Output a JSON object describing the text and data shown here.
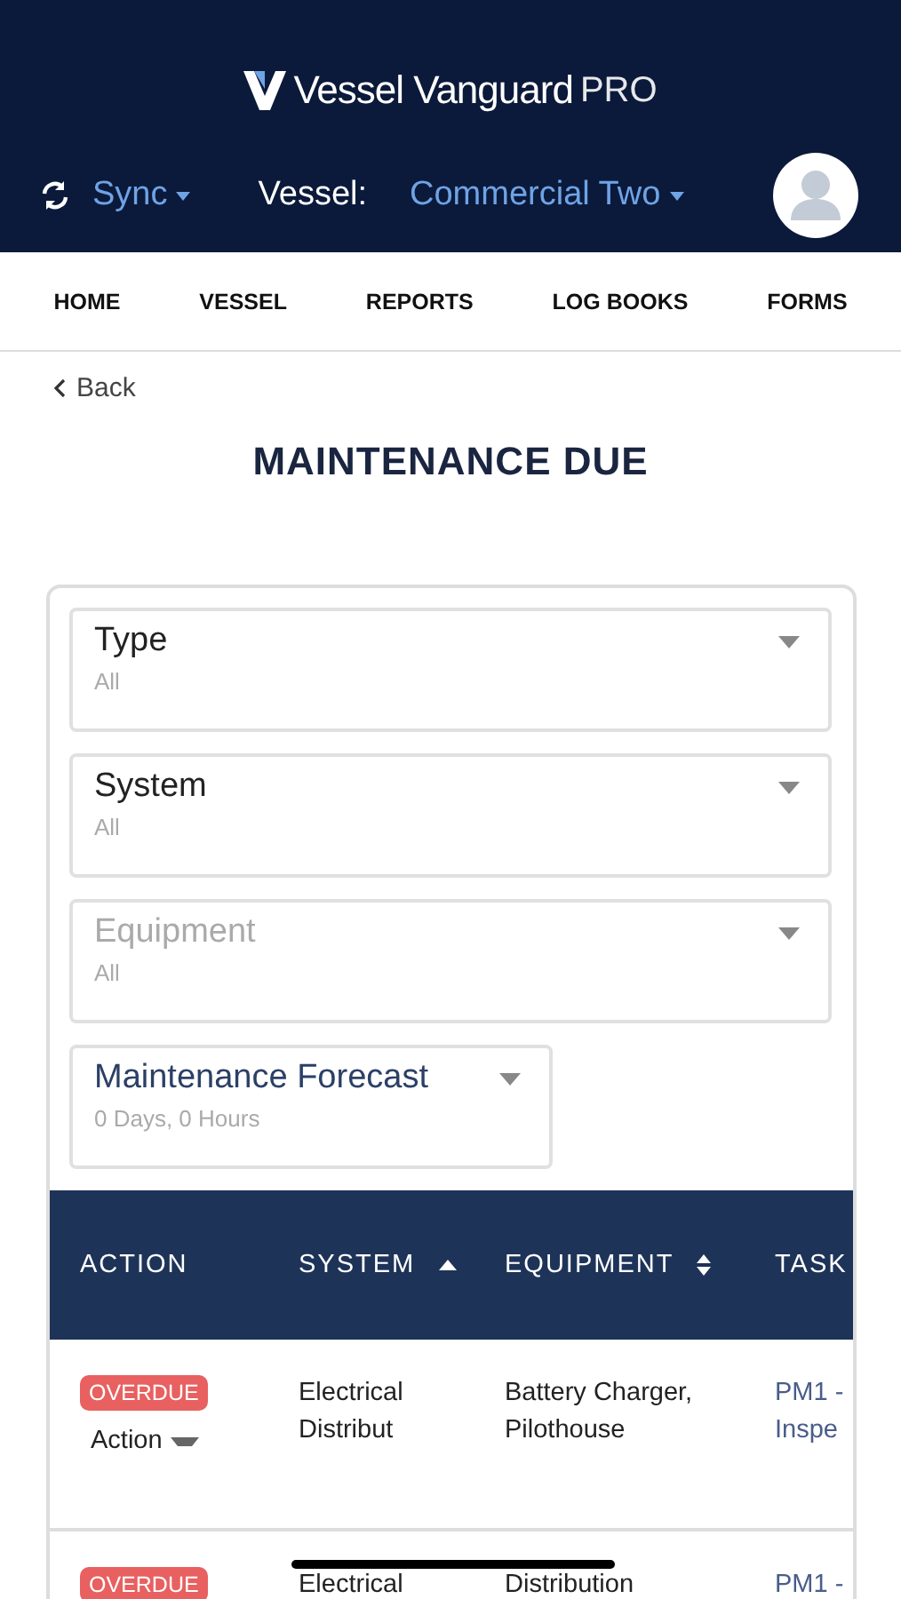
{
  "header": {
    "logo_main": "Vessel Vanguard",
    "logo_suffix": "PRO",
    "sync": "Sync",
    "vessel_label": "Vessel:",
    "vessel": "Commercial Two"
  },
  "nav": [
    "HOME",
    "VESSEL",
    "REPORTS",
    "LOG BOOKS",
    "FORMS"
  ],
  "back": "Back",
  "title": "MAINTENANCE DUE",
  "filters": [
    {
      "kind": "select",
      "label": "Type",
      "value": "All",
      "disabled": false
    },
    {
      "kind": "select",
      "label": "System",
      "value": "All",
      "disabled": false
    },
    {
      "kind": "select",
      "label": "Equipment",
      "value": "All",
      "disabled": true
    },
    {
      "kind": "forecast",
      "label": "Maintenance Forecast",
      "value": "0 Days, 0 Hours",
      "disabled": false
    }
  ],
  "table": {
    "columns": [
      {
        "label": "ACTION",
        "sortable": false
      },
      {
        "label": "SYSTEM",
        "sortable": true,
        "sorted": true
      },
      {
        "label": "EQUIPMENT",
        "sortable": true,
        "sorted": false
      },
      {
        "label": "TASK",
        "sortable": false
      }
    ],
    "rows": [
      {
        "status": "OVERDUE",
        "action": "Action",
        "system": "Electrical Distribut",
        "equipment": "Battery Charger, Pilothouse",
        "task": "PM1 - Inspe"
      },
      {
        "status": "OVERDUE",
        "system": "Electrical",
        "equipment": "Distribution",
        "task": "PM1 -"
      }
    ]
  }
}
